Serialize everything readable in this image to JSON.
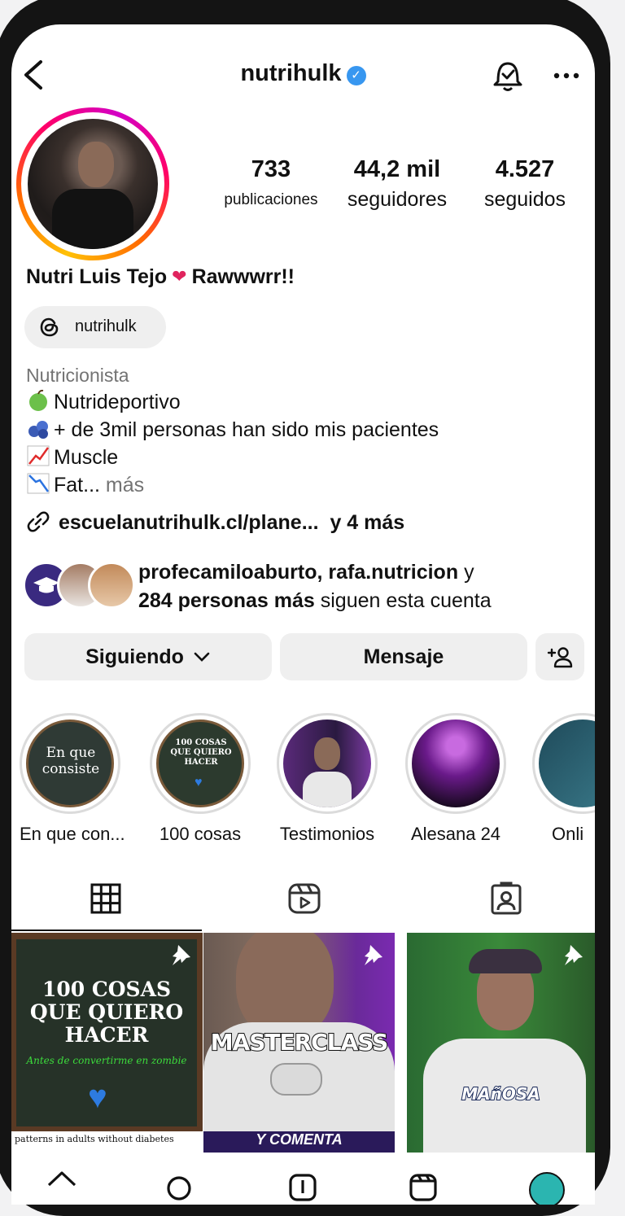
{
  "header": {
    "username": "nutrihulk"
  },
  "stats": [
    {
      "value": "733",
      "label": "publicaciones"
    },
    {
      "value": "44,2 mil",
      "label": "seguidores"
    },
    {
      "value": "4.527",
      "label": "seguidos"
    }
  ],
  "profile": {
    "full_name_a": "Nutri Luis Tejo",
    "full_name_b": "Rawwwrr!!",
    "threads_handle": "nutrihulk",
    "category": "Nutricionista",
    "bio_lines": [
      "Nutrideportivo",
      "+ de 3mil personas han sido mis pacientes",
      "Muscle",
      "Fat..."
    ],
    "bio_more": "más",
    "link_text": "escuelanutrihulk.cl/plane...",
    "link_more": "y 4 más"
  },
  "followed_by": {
    "names": "profecamiloaburto, rafa.nutricion",
    "connector": "y",
    "count_text": "284 personas más",
    "suffix": "siguen esta cuenta"
  },
  "actions": {
    "following": "Siguiendo",
    "message": "Mensaje"
  },
  "highlights": [
    {
      "label": "En que con...",
      "cover_text": "En que consiste"
    },
    {
      "label": "100 cosas",
      "cover_text": "100 COSAS QUE QUIERO HACER"
    },
    {
      "label": "Testimonios"
    },
    {
      "label": "Alesana 24"
    },
    {
      "label": "Onli"
    }
  ],
  "posts": [
    {
      "title": "100 COSAS QUE QUIERO HACER",
      "subtitle": "Antes de convertirme en zombie",
      "footer": "patterns in adults without diabetes"
    },
    {
      "title": "MASTERCLASS",
      "footer": "Y COMENTA"
    },
    {
      "title": "MAñOSA"
    }
  ],
  "colors": {
    "verified": "#3897f0",
    "link": "#00376b",
    "secondary_text": "#737373",
    "button_bg": "#efefef"
  }
}
